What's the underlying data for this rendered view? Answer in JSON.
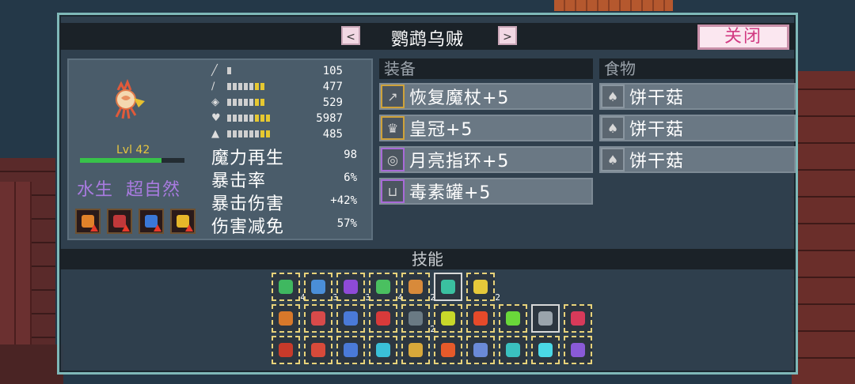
{
  "window": {
    "title": "鹦鹉乌贼",
    "prev_label": "<",
    "next_label": ">",
    "close_label": "关闭"
  },
  "character": {
    "level_text": "Lvl 42",
    "xp_progress": 0.78,
    "traits": [
      "水生",
      "超自然"
    ],
    "buffs": [
      {
        "icon": "fire-up-icon",
        "color": "#e0822a"
      },
      {
        "icon": "mushroom-up-icon",
        "color": "#c0383a"
      },
      {
        "icon": "blade-shield-icon",
        "color": "#3a78d8"
      },
      {
        "icon": "sparkle-icon",
        "color": "#e6b62a"
      }
    ],
    "stats": [
      {
        "icon": "sword-icon",
        "value": "105",
        "pips_white": 1,
        "pips_yellow": 0
      },
      {
        "icon": "wand-icon",
        "value": "477",
        "pips_white": 5,
        "pips_yellow": 2
      },
      {
        "icon": "shield-icon",
        "value": "529",
        "pips_white": 5,
        "pips_yellow": 2
      },
      {
        "icon": "heart-icon",
        "value": "5987",
        "pips_white": 5,
        "pips_yellow": 3
      },
      {
        "icon": "boot-icon",
        "value": "485",
        "pips_white": 6,
        "pips_yellow": 2
      }
    ],
    "derived": [
      {
        "label": "魔力再生",
        "value": "98"
      },
      {
        "label": "暴击率",
        "value": "6%"
      },
      {
        "label": "暴击伤害",
        "value": "+42%"
      },
      {
        "label": "伤害减免",
        "value": "57%"
      }
    ]
  },
  "equipment": {
    "header": "装备",
    "items": [
      {
        "label": "恢复魔杖+5",
        "icon": "staff-icon",
        "frame": "gold"
      },
      {
        "label": "皇冠+5",
        "icon": "crown-icon",
        "frame": "gold"
      },
      {
        "label": "月亮指环+5",
        "icon": "ring-icon",
        "frame": "purple"
      },
      {
        "label": "毒素罐+5",
        "icon": "jar-icon",
        "frame": "purple"
      }
    ]
  },
  "food": {
    "header": "食物",
    "items": [
      {
        "label": "饼干菇",
        "icon": "mushroom-icon"
      },
      {
        "label": "饼干菇",
        "icon": "mushroom-icon"
      },
      {
        "label": "饼干菇",
        "icon": "mushroom-icon"
      }
    ]
  },
  "skills": {
    "header": "技能",
    "row1": [
      {
        "icon": "rain-skill-icon",
        "color": "#3fb860",
        "count": "4"
      },
      {
        "icon": "water-skill-icon",
        "color": "#4a8ed8",
        "count": "3"
      },
      {
        "icon": "orb-skill-icon",
        "color": "#8e4ad8",
        "count": "3"
      },
      {
        "icon": "spray-skill-icon",
        "color": "#4ac060",
        "count": "4"
      },
      {
        "icon": "slash-skill-icon",
        "color": "#d88a3a",
        "count": "2"
      },
      {
        "icon": "arch-skill-icon",
        "color": "#3ac0a0",
        "count": "",
        "solid": true
      },
      {
        "icon": "lightning-skill-icon",
        "color": "#e6c83a",
        "count": "2"
      }
    ],
    "row2": [
      {
        "icon": "hourglass-skill-icon",
        "color": "#d8782a",
        "count": ""
      },
      {
        "icon": "capsule-skill-icon",
        "color": "#d84a4a",
        "count": ""
      },
      {
        "icon": "crown-skill-icon",
        "color": "#4a7ad8",
        "count": ""
      },
      {
        "icon": "ring-red-skill-icon",
        "color": "#d83a3a",
        "count": ""
      },
      {
        "icon": "rocks-skill-icon",
        "color": "#6a7a84",
        "count": "2"
      },
      {
        "icon": "halo-skill-icon",
        "color": "#c8d82a",
        "count": ""
      },
      {
        "icon": "flame-skill-icon",
        "color": "#e64a2a",
        "count": ""
      },
      {
        "icon": "leaf-skill-icon",
        "color": "#6ad83a",
        "count": ""
      },
      {
        "icon": "cloud-skill-icon",
        "color": "#9aa4ac",
        "count": "",
        "solid": true
      },
      {
        "icon": "gear-red-skill-icon",
        "color": "#d83a5a",
        "count": ""
      }
    ],
    "row3": [
      {
        "icon": "potion-skill-icon",
        "color": "#c83a2a",
        "count": ""
      },
      {
        "icon": "gem-skill-icon",
        "color": "#d84a3a",
        "count": ""
      },
      {
        "icon": "mystery-skill-icon",
        "color": "#4a7ad8",
        "count": ""
      },
      {
        "icon": "ring-teal-skill-icon",
        "color": "#3ac0d8",
        "count": ""
      },
      {
        "icon": "rainbow-skill-icon",
        "color": "#d8a83a",
        "count": ""
      },
      {
        "icon": "burst-skill-icon",
        "color": "#e65a2a",
        "count": ""
      },
      {
        "icon": "swirl-skill-icon",
        "color": "#6a8ad8",
        "count": ""
      },
      {
        "icon": "bubble-skill-icon",
        "color": "#3ac0c0",
        "count": ""
      },
      {
        "icon": "bolt-skill-icon",
        "color": "#4ad8e6",
        "count": ""
      },
      {
        "icon": "feather-skill-icon",
        "color": "#8a5ad8",
        "count": ""
      }
    ]
  }
}
